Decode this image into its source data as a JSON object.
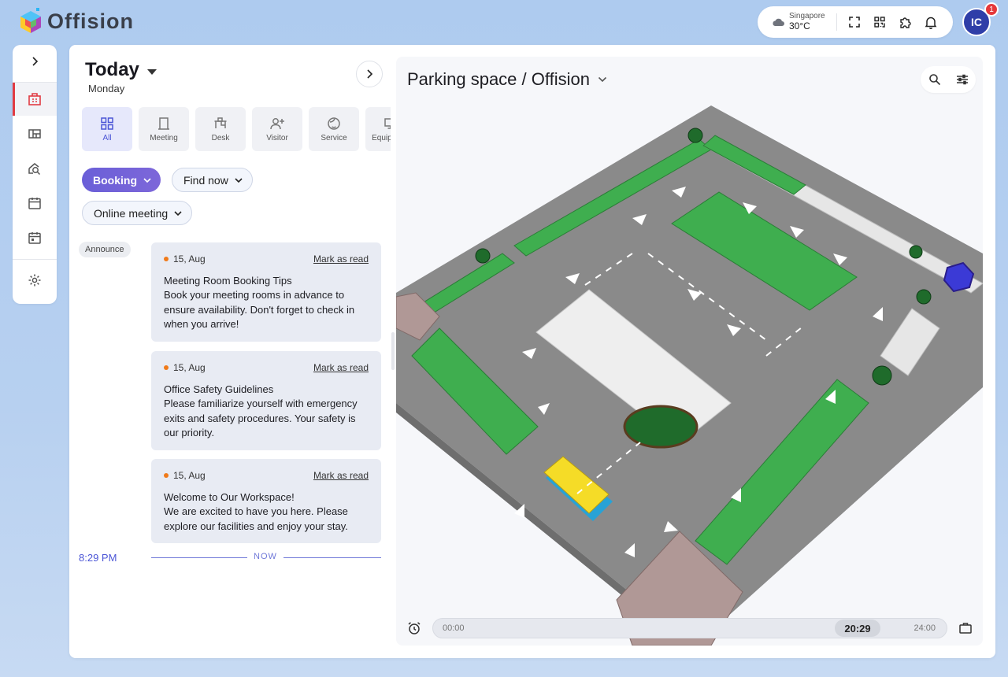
{
  "app": {
    "name": "Offision"
  },
  "header": {
    "weather": {
      "city": "Singapore",
      "temp": "30°C"
    },
    "user_initials": "IC",
    "notification_count": "1"
  },
  "today": {
    "title": "Today",
    "day": "Monday"
  },
  "categories": [
    {
      "label": "All",
      "icon": "grid-icon",
      "active": true
    },
    {
      "label": "Meeting",
      "icon": "door-icon"
    },
    {
      "label": "Desk",
      "icon": "desk-icon"
    },
    {
      "label": "Visitor",
      "icon": "add-person-icon"
    },
    {
      "label": "Service",
      "icon": "face-icon"
    },
    {
      "label": "Equipment",
      "icon": "monitor-icon"
    }
  ],
  "filters": {
    "booking": "Booking",
    "find_now": "Find now",
    "online_meeting": "Online meeting"
  },
  "announce_label": "Announce",
  "announcements": [
    {
      "date": "15, Aug",
      "mark": "Mark as read",
      "title": "Meeting Room Booking Tips",
      "body": "Book your meeting rooms in advance to ensure availability. Don't forget to check in when you arrive!"
    },
    {
      "date": "15, Aug",
      "mark": "Mark as read",
      "title": "Office Safety Guidelines",
      "body": "Please familiarize yourself with emergency exits and safety procedures. Your safety is our priority."
    },
    {
      "date": "15, Aug",
      "mark": "Mark as read",
      "title": "Welcome to Our Workspace!",
      "body": "We are excited to have you here. Please explore our facilities and enjoy your stay."
    }
  ],
  "now": {
    "time": "8:29 PM",
    "label": "NOW"
  },
  "map": {
    "title": "Parking space / Offision"
  },
  "timeline": {
    "start": "00:00",
    "current": "20:29",
    "end": "24:00"
  },
  "colors": {
    "accent": "#4b55d6",
    "nav_active": "#e13b43",
    "booking_chip": "#6a5fd8",
    "parking_spot": "#3fae4f",
    "road": "#8c8c8c"
  }
}
